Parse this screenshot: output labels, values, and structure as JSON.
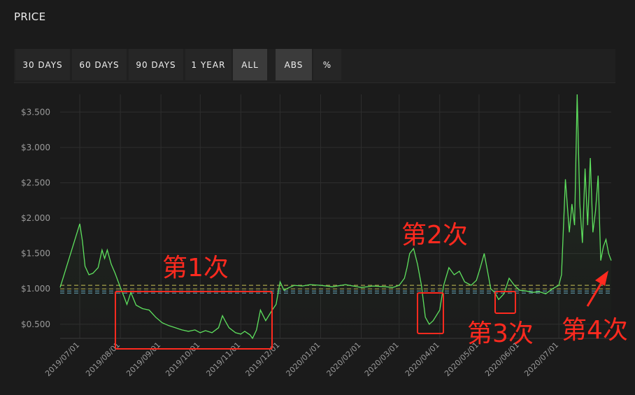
{
  "header": {
    "title": "PRICE"
  },
  "toolbar": {
    "range_buttons": [
      {
        "label": "30 DAYS",
        "active": false
      },
      {
        "label": "60 DAYS",
        "active": false
      },
      {
        "label": "90 DAYS",
        "active": false
      },
      {
        "label": "1 YEAR",
        "active": false
      },
      {
        "label": "ALL",
        "active": true
      }
    ],
    "mode_buttons": [
      {
        "label": "ABS",
        "active": true
      },
      {
        "label": "%",
        "active": false
      }
    ]
  },
  "colors": {
    "line": "#5ee05e",
    "annotation": "#ff2a1f",
    "grid": "#2e2e2e",
    "axis_text": "#9a9a9a",
    "ref_line_yellow": "#a7a24a",
    "ref_line_blue": "#5b8ea0"
  },
  "chart_data": {
    "type": "line",
    "title": "",
    "xlabel": "",
    "ylabel": "",
    "x_ticks": [
      "2019/07/01",
      "2019/08/01",
      "2019/09/01",
      "2019/10/01",
      "2019/11/01",
      "2019/12/01",
      "2020/01/01",
      "2020/02/01",
      "2020/03/01",
      "2020/04/01",
      "2020/05/01",
      "2020/06/01",
      "2020/07/01"
    ],
    "y_ticks": [
      "$0.500",
      "$1.000",
      "$1.500",
      "$2.000",
      "$2.500",
      "$3.000",
      "$3.500"
    ],
    "ylim": [
      0.3,
      3.75
    ],
    "grid": true,
    "reference_lines": [
      1.05,
      1.0,
      0.97,
      0.94
    ],
    "series": [
      {
        "x": [
          "2019-06-16",
          "2019-07-01",
          "2019-07-03",
          "2019-07-05",
          "2019-07-08",
          "2019-07-11",
          "2019-07-15",
          "2019-07-18",
          "2019-07-20",
          "2019-07-22",
          "2019-07-25",
          "2019-07-28",
          "2019-08-01",
          "2019-08-04",
          "2019-08-06",
          "2019-08-09",
          "2019-08-13",
          "2019-08-18",
          "2019-08-23",
          "2019-08-28",
          "2019-09-02",
          "2019-09-07",
          "2019-09-12",
          "2019-09-17",
          "2019-09-22",
          "2019-09-27",
          "2019-10-01",
          "2019-10-05",
          "2019-10-10",
          "2019-10-15",
          "2019-10-18",
          "2019-10-20",
          "2019-10-23",
          "2019-10-28",
          "2019-11-01",
          "2019-11-04",
          "2019-11-08",
          "2019-11-10",
          "2019-11-13",
          "2019-11-16",
          "2019-11-20",
          "2019-11-25",
          "2019-11-28",
          "2019-12-01",
          "2019-12-04",
          "2019-12-08",
          "2019-12-12",
          "2019-12-18",
          "2019-12-24",
          "2020-01-01",
          "2020-01-10",
          "2020-01-20",
          "2020-02-01",
          "2020-02-10",
          "2020-02-20",
          "2020-02-25",
          "2020-03-01",
          "2020-03-05",
          "2020-03-07",
          "2020-03-09",
          "2020-03-12",
          "2020-03-15",
          "2020-03-18",
          "2020-03-21",
          "2020-03-24",
          "2020-03-27",
          "2020-04-01",
          "2020-04-04",
          "2020-04-08",
          "2020-04-12",
          "2020-04-16",
          "2020-04-20",
          "2020-04-25",
          "2020-04-29",
          "2020-05-02",
          "2020-05-05",
          "2020-05-07",
          "2020-05-10",
          "2020-05-13",
          "2020-05-16",
          "2020-05-20",
          "2020-05-24",
          "2020-05-28",
          "2020-06-01",
          "2020-06-06",
          "2020-06-11",
          "2020-06-16",
          "2020-06-21",
          "2020-06-26",
          "2020-07-01",
          "2020-07-03",
          "2020-07-06",
          "2020-07-09",
          "2020-07-11",
          "2020-07-13",
          "2020-07-15",
          "2020-07-17",
          "2020-07-19",
          "2020-07-21",
          "2020-07-23",
          "2020-07-25",
          "2020-07-27",
          "2020-07-29",
          "2020-07-31",
          "2020-08-02",
          "2020-08-04",
          "2020-08-06",
          "2020-08-08",
          "2020-08-10"
        ],
        "y": [
          1.02,
          1.92,
          1.68,
          1.32,
          1.2,
          1.22,
          1.3,
          1.55,
          1.43,
          1.55,
          1.35,
          1.22,
          1.02,
          0.88,
          0.78,
          0.95,
          0.77,
          0.72,
          0.7,
          0.6,
          0.52,
          0.48,
          0.45,
          0.42,
          0.4,
          0.42,
          0.38,
          0.41,
          0.38,
          0.45,
          0.62,
          0.55,
          0.45,
          0.38,
          0.36,
          0.4,
          0.35,
          0.3,
          0.42,
          0.7,
          0.55,
          0.7,
          0.78,
          1.1,
          0.98,
          1.02,
          1.05,
          1.04,
          1.06,
          1.05,
          1.03,
          1.06,
          1.02,
          1.04,
          1.03,
          1.02,
          1.05,
          1.15,
          1.3,
          1.5,
          1.57,
          1.35,
          1.05,
          0.6,
          0.5,
          0.55,
          0.7,
          1.05,
          1.3,
          1.2,
          1.25,
          1.1,
          1.05,
          1.12,
          1.3,
          1.5,
          1.3,
          1.0,
          0.95,
          0.85,
          0.93,
          1.15,
          1.05,
          0.98,
          0.97,
          0.95,
          0.96,
          0.93,
          1.0,
          1.05,
          1.2,
          2.55,
          1.8,
          2.2,
          1.9,
          3.75,
          2.2,
          1.65,
          2.7,
          1.9,
          2.85,
          1.8,
          2.1,
          2.6,
          1.4,
          1.6,
          1.7,
          1.5,
          1.4
        ]
      }
    ],
    "annotations": [
      {
        "text": "第1次"
      },
      {
        "text": "第2次"
      },
      {
        "text": "第3次"
      },
      {
        "text": "第4次"
      }
    ]
  }
}
